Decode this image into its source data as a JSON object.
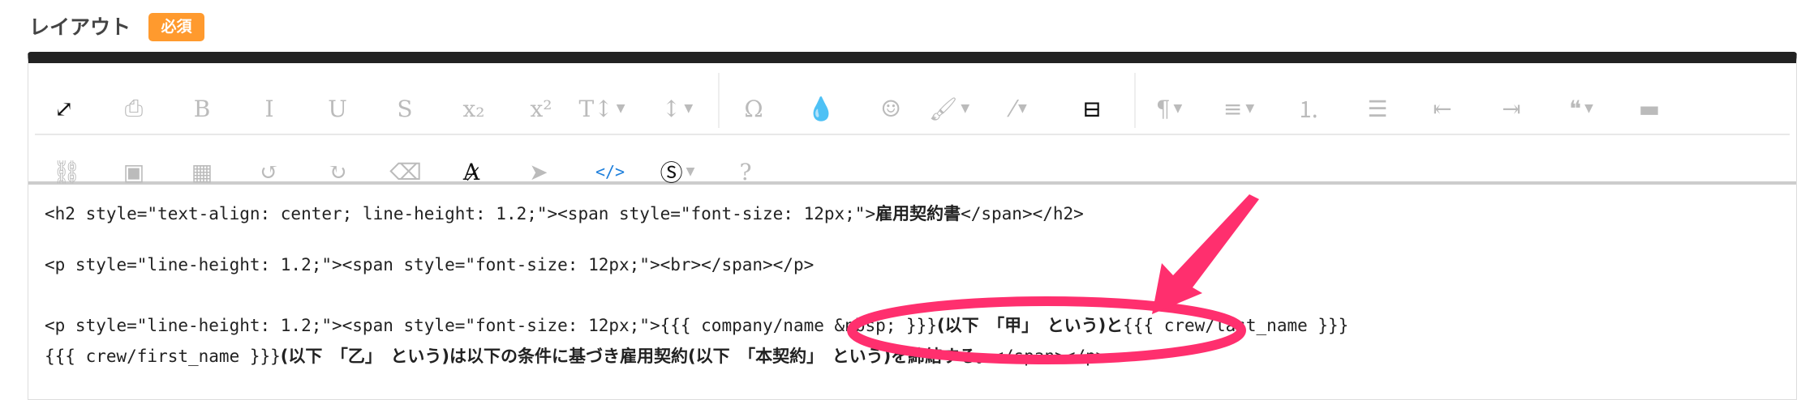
{
  "field": {
    "label": "レイアウト",
    "required_badge": "必須"
  },
  "toolbar": {
    "row1": [
      {
        "name": "fullscreen-icon",
        "glyph": "⤢",
        "state": "dark"
      },
      {
        "name": "print-icon",
        "glyph": "⎙"
      },
      {
        "name": "bold-icon",
        "glyph": "B"
      },
      {
        "name": "italic-icon",
        "glyph": "I"
      },
      {
        "name": "underline-icon",
        "glyph": "U"
      },
      {
        "name": "strikethrough-icon",
        "glyph": "S"
      },
      {
        "name": "subscript-icon",
        "glyph": "x₂"
      },
      {
        "name": "superscript-icon",
        "glyph": "x²"
      },
      {
        "name": "font-size-icon",
        "glyph": "T↕",
        "dropdown": true
      },
      {
        "name": "line-height-icon",
        "glyph": "↕",
        "dropdown": true
      },
      {
        "name": "special-chars-icon",
        "glyph": "Ω"
      },
      {
        "name": "color-icon",
        "glyph": "💧"
      },
      {
        "name": "emoji-icon",
        "glyph": "☺"
      },
      {
        "name": "paint-brush-icon",
        "glyph": "🖌",
        "dropdown": true
      },
      {
        "name": "magic-wand-icon",
        "glyph": "⁄",
        "dropdown": true
      },
      {
        "name": "page-break-icon",
        "glyph": "⊟",
        "state": "dark"
      },
      {
        "name": "paragraph-icon",
        "glyph": "¶",
        "dropdown": true
      },
      {
        "name": "align-icon",
        "glyph": "≡",
        "dropdown": true
      },
      {
        "name": "ordered-list-icon",
        "glyph": "⒈"
      },
      {
        "name": "unordered-list-icon",
        "glyph": "☰"
      },
      {
        "name": "outdent-icon",
        "glyph": "⇤"
      },
      {
        "name": "indent-icon",
        "glyph": "⇥"
      },
      {
        "name": "quote-icon",
        "glyph": "❝",
        "dropdown": true
      },
      {
        "name": "horizontal-rule-icon",
        "glyph": "▬"
      }
    ],
    "row2": [
      {
        "name": "link-icon",
        "glyph": "⛓"
      },
      {
        "name": "image-icon",
        "glyph": "▣"
      },
      {
        "name": "table-icon",
        "glyph": "▦"
      },
      {
        "name": "undo-icon",
        "glyph": "↺"
      },
      {
        "name": "redo-icon",
        "glyph": "↻"
      },
      {
        "name": "eraser-icon",
        "glyph": "⌫"
      },
      {
        "name": "clear-format-icon",
        "glyph": "A̷",
        "state": "dark"
      },
      {
        "name": "select-cursor-icon",
        "glyph": "➤"
      },
      {
        "name": "code-view-icon",
        "glyph": "</>",
        "state": "blue"
      },
      {
        "name": "snippet-icon",
        "glyph": "Ⓢ",
        "dropdown": true,
        "state": "dark"
      },
      {
        "name": "help-icon",
        "glyph": "?"
      }
    ]
  },
  "content": {
    "line1": {
      "code_a": "<h2 style=\"text-align: center; line-height: 1.2;\"><span style=\"font-size: 12px;\">",
      "jp": "雇用契約書",
      "code_b": "</span></h2>"
    },
    "line2": {
      "code": "<p style=\"line-height: 1.2;\"><span style=\"font-size: 12px;\"><br></span></p>"
    },
    "line3": {
      "code_a": "<p style=\"line-height: 1.2;\"><span style=\"font-size: 12px;\">",
      "var1": "{{{ company/name &nbsp; }}}",
      "jp1": "(以下　「甲」　という)と",
      "var2": "{{{ crew/last_name }}}"
    },
    "line4": {
      "var3": "{{{ crew/first_name }}}",
      "jp2": "(以下　「乙」　という)は以下の条件に基づき雇用契約(以下　「本契約」　という)を締結する。",
      "code_b": "</span></p>"
    }
  },
  "colors": {
    "accent": "#ff9a2e",
    "annotation": "#ff2f6e",
    "code_blue": "#1e7fdb"
  }
}
